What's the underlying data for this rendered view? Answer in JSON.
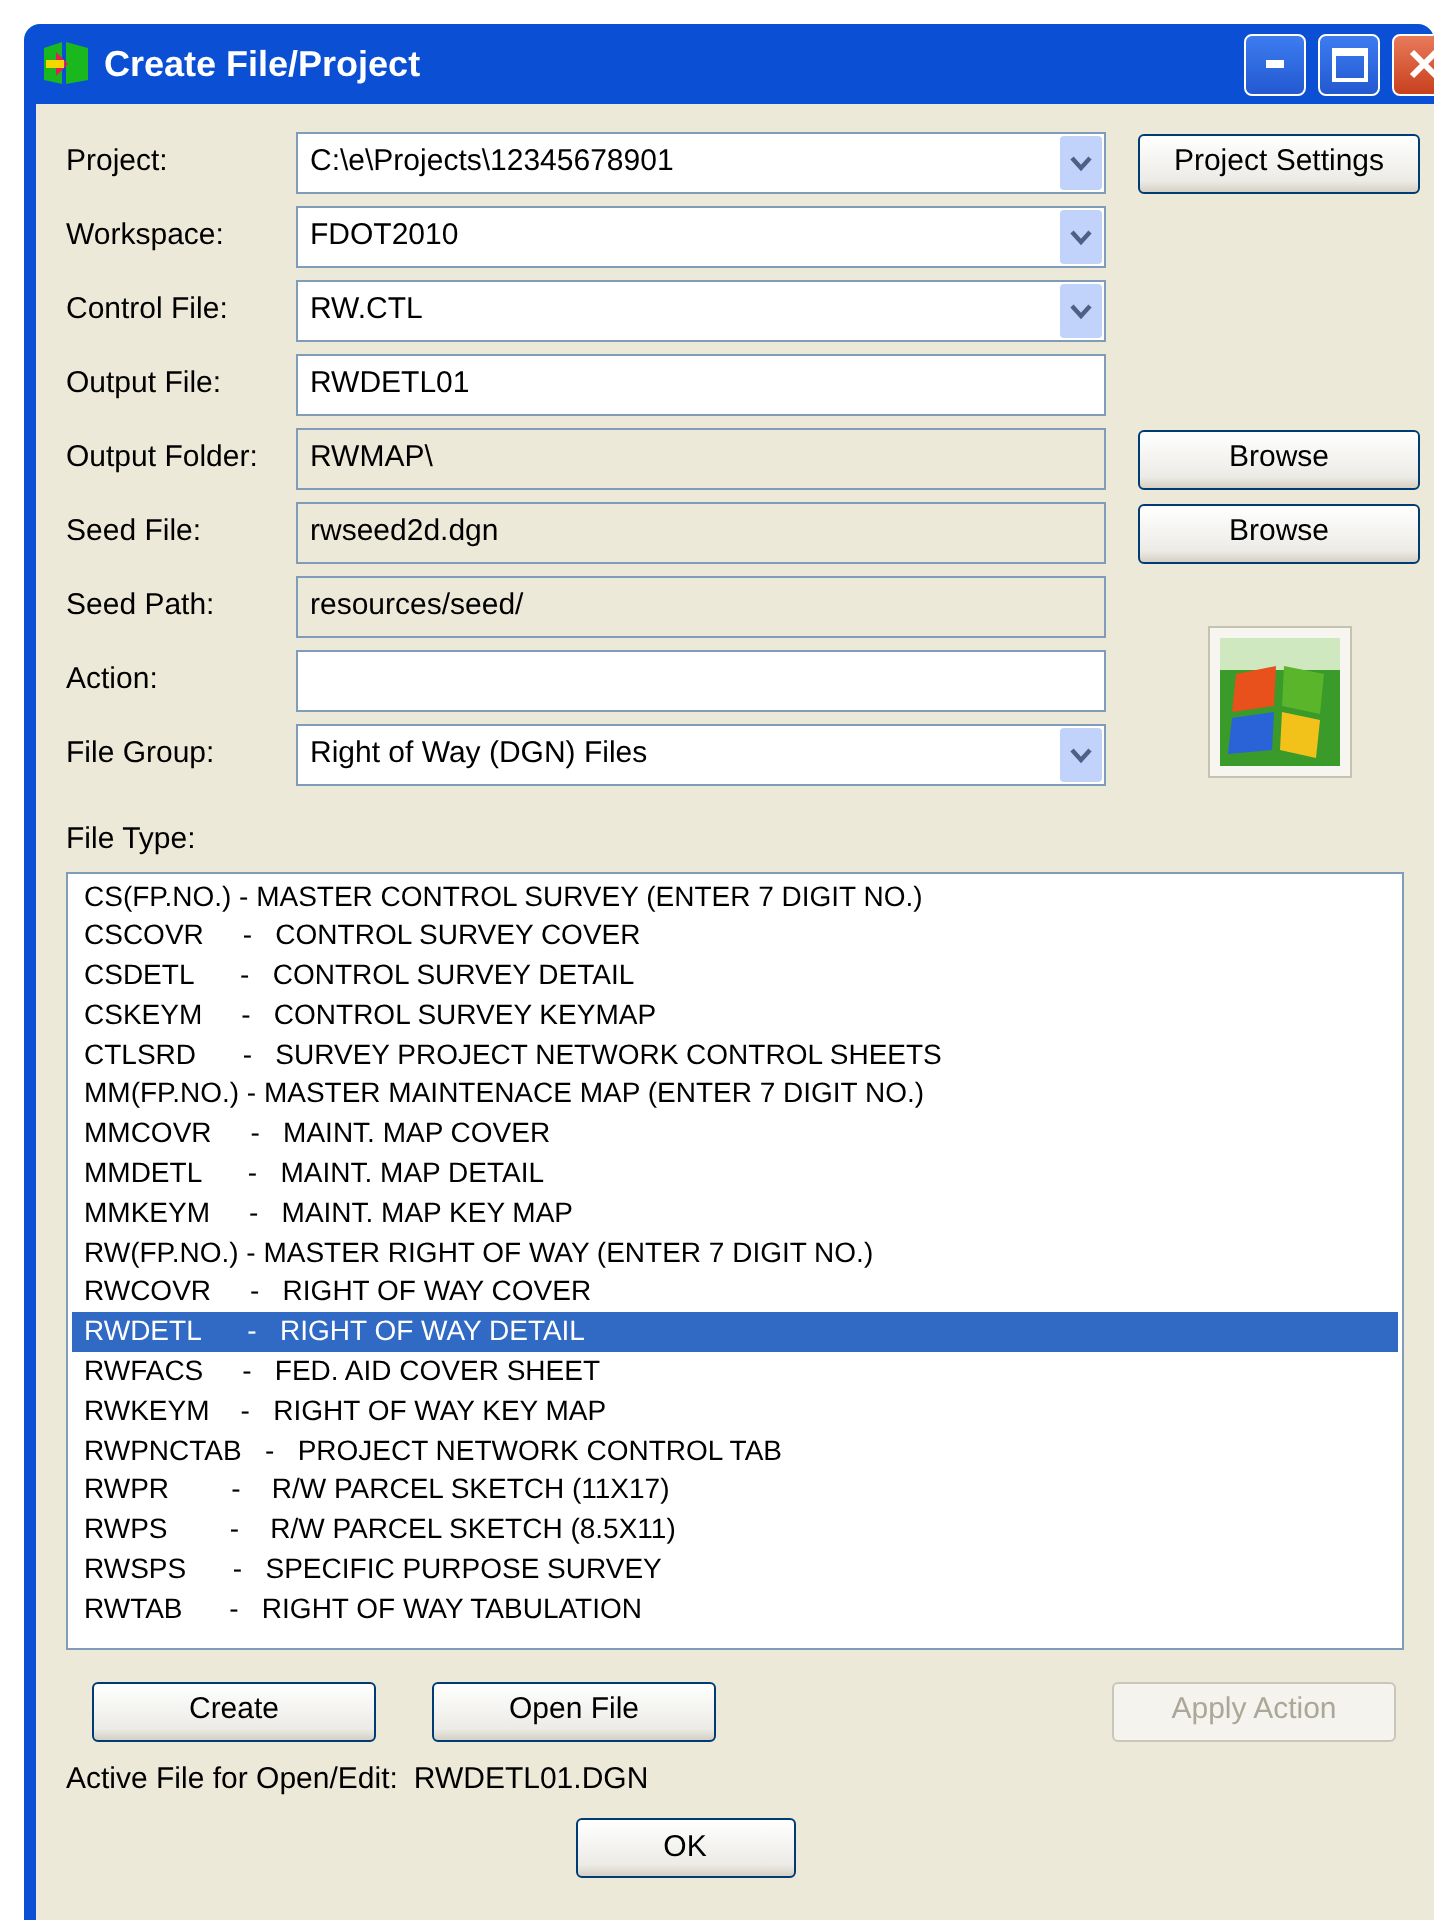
{
  "window": {
    "title": "Create File/Project"
  },
  "fields": [
    {
      "label": "Project:",
      "kind": "combo",
      "value": "C:\\e\\Projects\\12345678901",
      "button": "Project Settings"
    },
    {
      "label": "Workspace:",
      "kind": "combo",
      "value": "FDOT2010"
    },
    {
      "label": "Control File:",
      "kind": "combo",
      "value": "RW.CTL"
    },
    {
      "label": "Output File:",
      "kind": "text",
      "value": "RWDETL01"
    },
    {
      "label": "Output Folder:",
      "kind": "readonly",
      "value": "RWMAP\\",
      "button": "Browse"
    },
    {
      "label": "Seed File:",
      "kind": "readonly",
      "value": "rwseed2d.dgn",
      "button": "Browse"
    },
    {
      "label": "Seed Path:",
      "kind": "readonly",
      "value": "resources/seed/"
    },
    {
      "label": "Action:",
      "kind": "text"
    },
    {
      "label": "File Group:",
      "kind": "combo",
      "value": "Right of Way (DGN) Files"
    }
  ],
  "file_type": {
    "label": "File Type:",
    "items": [
      {
        "text": "CS(FP.NO.) - MASTER CONTROL SURVEY (ENTER 7 DIGIT NO.)",
        "selected": false
      },
      {
        "text": "CSCOVR     -   CONTROL SURVEY COVER",
        "selected": false
      },
      {
        "text": "CSDETL      -   CONTROL SURVEY DETAIL",
        "selected": false
      },
      {
        "text": "CSKEYM     -   CONTROL SURVEY KEYMAP",
        "selected": false
      },
      {
        "text": "CTLSRD      -   SURVEY PROJECT NETWORK CONTROL SHEETS",
        "selected": false
      },
      {
        "text": "MM(FP.NO.) - MASTER MAINTENACE MAP (ENTER 7 DIGIT NO.)",
        "selected": false
      },
      {
        "text": "MMCOVR     -   MAINT. MAP COVER",
        "selected": false
      },
      {
        "text": "MMDETL      -   MAINT. MAP DETAIL",
        "selected": false
      },
      {
        "text": "MMKEYM     -   MAINT. MAP KEY MAP",
        "selected": false
      },
      {
        "text": "RW(FP.NO.) - MASTER RIGHT OF WAY (ENTER 7 DIGIT NO.)",
        "selected": false
      },
      {
        "text": "RWCOVR     -   RIGHT OF WAY COVER",
        "selected": false
      },
      {
        "text": "RWDETL      -   RIGHT OF WAY DETAIL",
        "selected": true
      },
      {
        "text": "RWFACS     -   FED. AID COVER SHEET",
        "selected": false
      },
      {
        "text": "RWKEYM    -   RIGHT OF WAY KEY MAP",
        "selected": false
      },
      {
        "text": "RWPNCTAB   -   PROJECT NETWORK CONTROL TAB",
        "selected": false
      },
      {
        "text": "RWPR        -    R/W PARCEL SKETCH (11X17)",
        "selected": false
      },
      {
        "text": "RWPS        -    R/W PARCEL SKETCH (8.5X11)",
        "selected": false
      },
      {
        "text": "RWSPS      -   SPECIFIC PURPOSE SURVEY",
        "selected": false
      },
      {
        "text": "RWTAB      -   RIGHT OF WAY TABULATION",
        "selected": false
      }
    ]
  },
  "buttons": [
    {
      "label": "Create",
      "disabled": false
    },
    {
      "label": "Open File",
      "disabled": false
    },
    {
      "label": "Apply Action",
      "disabled": true
    }
  ],
  "active_file": {
    "label": "Active File for Open/Edit:",
    "value": "RWDETL01.DGN"
  },
  "ok_button": "OK"
}
